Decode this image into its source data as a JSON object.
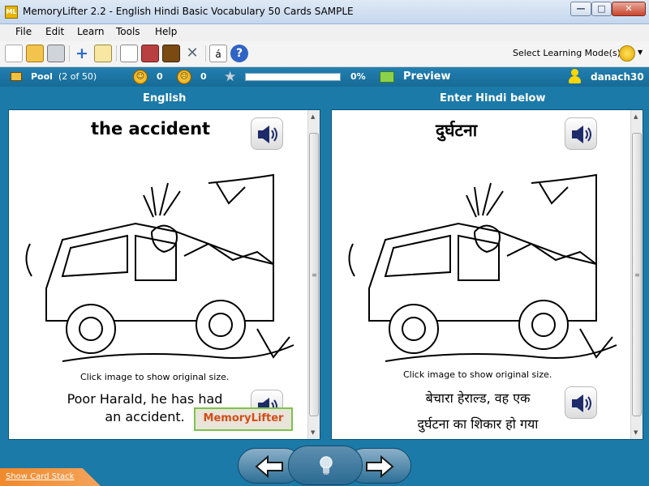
{
  "window": {
    "app_icon_text": "ML",
    "title": "MemoryLifter 2.2 - English Hindi Basic Vocabulary 50 Cards SAMPLE",
    "min": "—",
    "max": "□",
    "close": "✕"
  },
  "menu": [
    "File",
    "Edit",
    "Learn",
    "Tools",
    "Help"
  ],
  "toolbar": {
    "select_mode_label": "Select Learning Mode(s)",
    "icons": [
      "new-icon",
      "open-icon",
      "print-icon",
      "add-icon",
      "edit-icon",
      "slideshow-icon",
      "stats-icon",
      "box-icon",
      "tools-icon",
      "special-chars-icon",
      "help-icon"
    ],
    "special_chars": "á",
    "help": "?"
  },
  "status": {
    "pool_label": "Pool",
    "pool_count": "(2 of 50)",
    "correct_count": "0",
    "wrong_count": "0",
    "progress_percent": 0,
    "progress_label": "0%",
    "preview_label": "Preview",
    "username": "danach30"
  },
  "question": {
    "column_header": "English",
    "word": "the accident",
    "hint": "Click image to show original size.",
    "sentence_line1": "Poor Harald, he has had",
    "sentence_line2": "an accident.",
    "watermark": "MemoryLifter"
  },
  "answer": {
    "column_header": "Enter Hindi below",
    "word": "दुर्घटना",
    "hint": "Click image to show original size.",
    "sentence_line1": "बेचारा हेराल्ड, वह एक",
    "sentence_line2": "दुर्घटना का शिकार हो गया"
  },
  "footer": {
    "show_card_stack": "Show Card Stack"
  },
  "colors": {
    "main_bg": "#1b7aa8",
    "progress_fill": "#55c24a",
    "stack_tab": "#f08a2c"
  }
}
